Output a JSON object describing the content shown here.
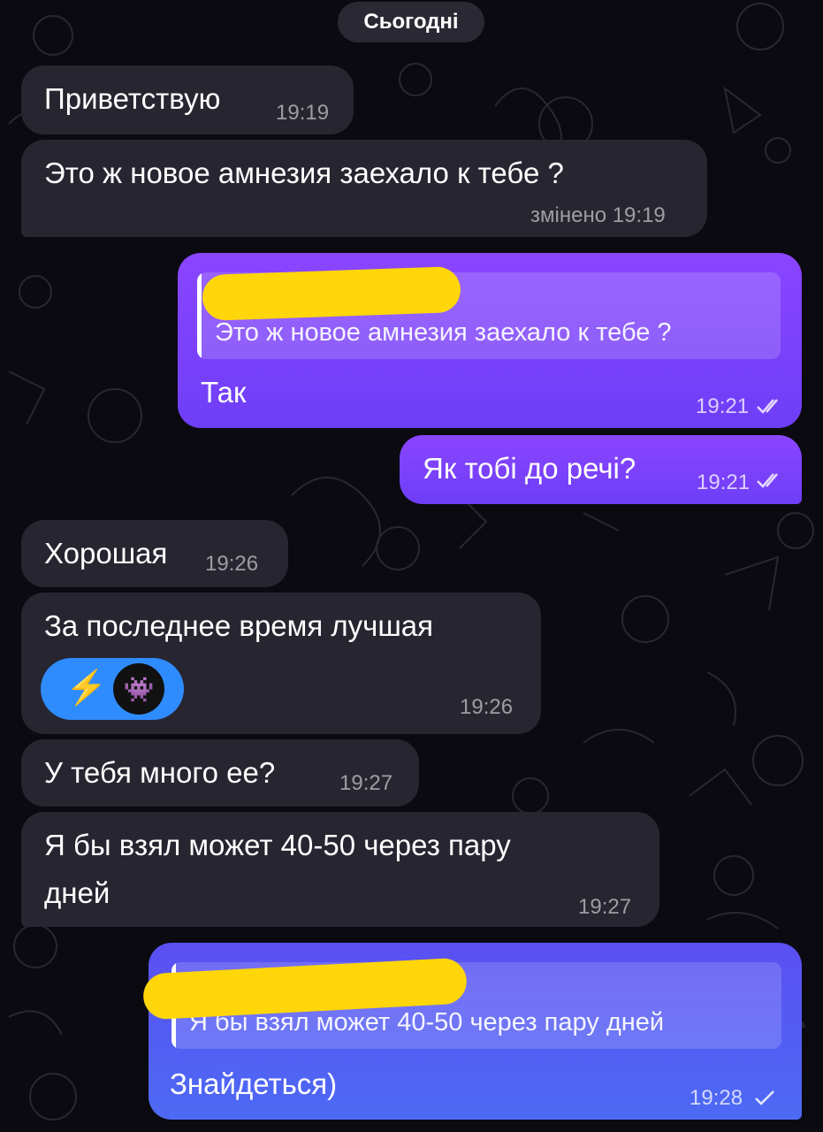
{
  "date_separator": "Сьогодні",
  "messages": [
    {
      "text": "Приветствую",
      "time": "19:19"
    },
    {
      "text": "Это ж новое амнезия заехало к тебе ?",
      "time": "змінено 19:19"
    },
    {
      "reply_quote": "Это ж новое амнезия заехало к тебе ?",
      "text": "Так",
      "time": "19:21",
      "status": "read"
    },
    {
      "text": "Як тобі до речі?",
      "time": "19:21",
      "status": "read"
    },
    {
      "text": "Хорошая",
      "time": "19:26"
    },
    {
      "text": "За последнее время лучшая",
      "time": "19:26",
      "reaction": {
        "emoji": "⚡",
        "avatar_emoji": "👾"
      }
    },
    {
      "text": "У тебя много ее?",
      "time": "19:27"
    },
    {
      "text_line1": "Я бы взял может 40-50 через пару",
      "text_line2": "дней",
      "time": "19:27"
    },
    {
      "reply_quote": "Я бы взял может 40-50 через пару дней",
      "text": "Знайдеться)",
      "time": "19:28",
      "status": "sent"
    }
  ],
  "colors": {
    "background": "#0b0a10",
    "incoming_bubble": "#272530",
    "outgoing_purple": "#7b42fb",
    "outgoing_blue": "#5160f3",
    "redaction": "#ffd60a",
    "reaction_pill": "#2f8cff"
  },
  "icons": [
    "double-check-icon",
    "single-check-icon",
    "lightning-icon",
    "space-invader-icon"
  ]
}
